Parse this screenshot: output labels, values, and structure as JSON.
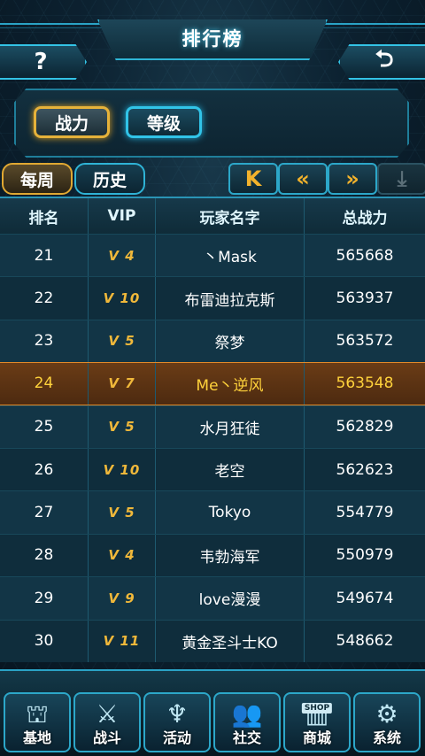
{
  "header": {
    "title": "排行榜",
    "help_label": "?",
    "back_label": "⮌"
  },
  "tabs": [
    {
      "label": "战力",
      "active": true
    },
    {
      "label": "等级",
      "active": false
    }
  ],
  "sub_tabs": [
    {
      "label": "每周",
      "active": true
    },
    {
      "label": "历史",
      "active": false
    }
  ],
  "pager": {
    "first": "K",
    "prev": "«",
    "next": "»",
    "last": "⤓"
  },
  "table": {
    "headers": {
      "rank": "排名",
      "vip": "VIP",
      "name": "玩家名字",
      "power": "总战力"
    },
    "rows": [
      {
        "rank": "21",
        "vip": "V 4",
        "name": "丶Mask",
        "power": "565668"
      },
      {
        "rank": "22",
        "vip": "V 10",
        "name": "布雷迪拉克斯",
        "power": "563937"
      },
      {
        "rank": "23",
        "vip": "V 5",
        "name": "祭梦",
        "power": "563572"
      },
      {
        "rank": "24",
        "vip": "V 7",
        "name": "Me丶逆风",
        "power": "563548"
      },
      {
        "rank": "25",
        "vip": "V 5",
        "name": "水月狂徒",
        "power": "562829"
      },
      {
        "rank": "26",
        "vip": "V 10",
        "name": "老空",
        "power": "562623"
      },
      {
        "rank": "27",
        "vip": "V 5",
        "name": "Tokyo",
        "power": "554779"
      },
      {
        "rank": "28",
        "vip": "V 4",
        "name": "韦勃海军",
        "power": "550979"
      },
      {
        "rank": "29",
        "vip": "V 9",
        "name": "love漫漫",
        "power": "549674"
      },
      {
        "rank": "30",
        "vip": "V 11",
        "name": "黄金圣斗士KO",
        "power": "548662"
      }
    ],
    "highlighted_rank": "24"
  },
  "nav": [
    {
      "label": "基地",
      "icon": "base-icon"
    },
    {
      "label": "战斗",
      "icon": "battle-icon"
    },
    {
      "label": "活动",
      "icon": "event-icon"
    },
    {
      "label": "社交",
      "icon": "social-icon"
    },
    {
      "label": "商城",
      "icon": "shop-icon",
      "tag": "SHOP"
    },
    {
      "label": "系统",
      "icon": "settings-icon"
    }
  ],
  "colors": {
    "accent": "#2fb5d6",
    "gold": "#e6b23a",
    "highlight_text": "#ffd23b"
  }
}
